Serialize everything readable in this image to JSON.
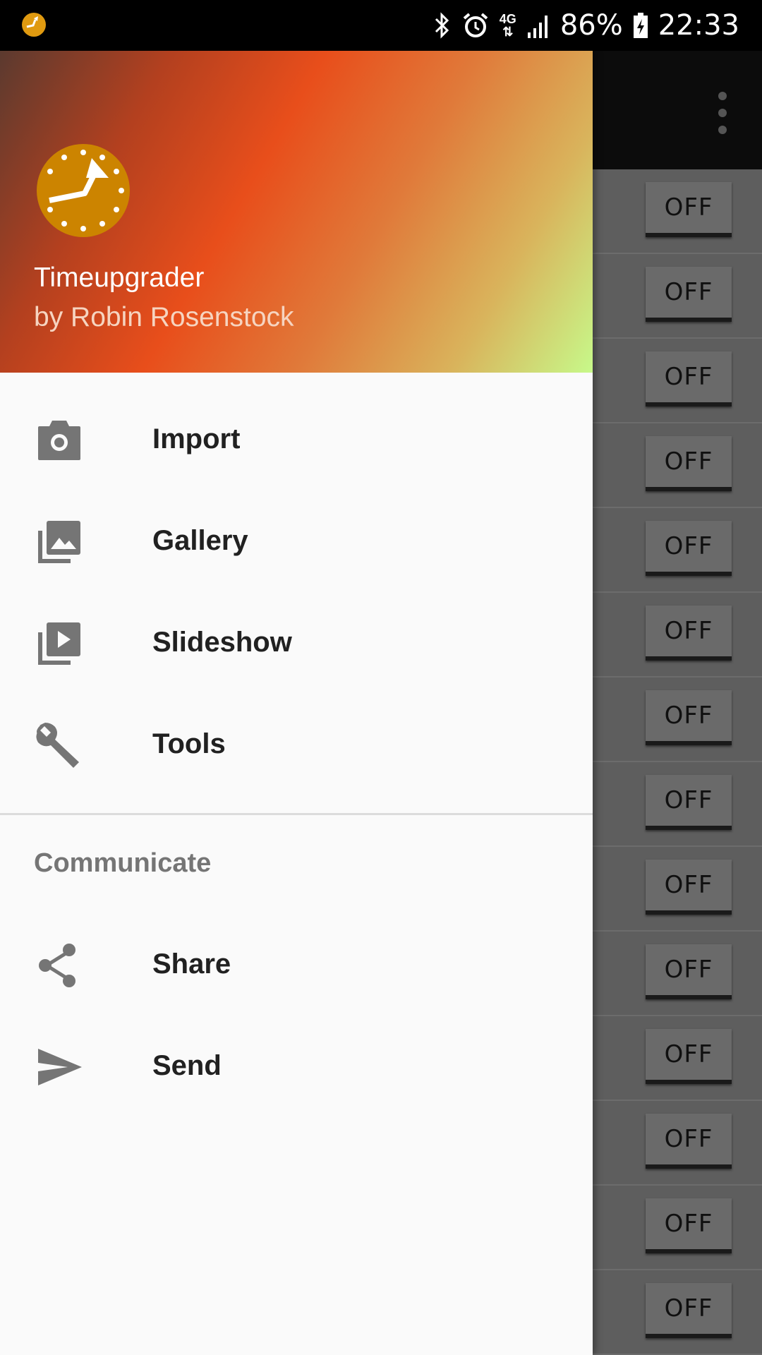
{
  "status_bar": {
    "battery_percent": "86%",
    "time": "22:33",
    "network": "4G"
  },
  "drawer": {
    "app_name": "Timeupgrader",
    "author": "by Robin Rosenstock",
    "items": [
      {
        "label": "Import",
        "icon": "camera-icon"
      },
      {
        "label": "Gallery",
        "icon": "gallery-icon"
      },
      {
        "label": "Slideshow",
        "icon": "slideshow-icon"
      },
      {
        "label": "Tools",
        "icon": "wrench-icon"
      }
    ],
    "section_title": "Communicate",
    "communicate_items": [
      {
        "label": "Share",
        "icon": "share-icon"
      },
      {
        "label": "Send",
        "icon": "send-icon"
      }
    ]
  },
  "background": {
    "toggle_label": "OFF"
  },
  "colors": {
    "logo": "#cc8400",
    "header_gradient": [
      "#5b3a2f",
      "#e84e1b",
      "#c7f98a"
    ],
    "drawer_bg": "#fafafa"
  }
}
